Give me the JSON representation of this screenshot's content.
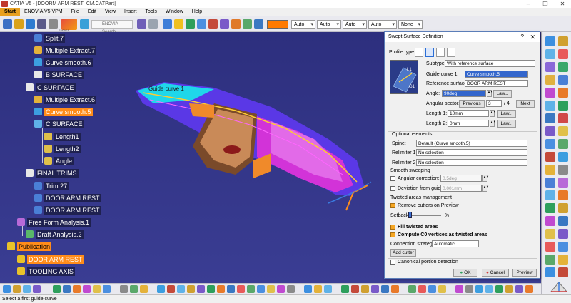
{
  "window": {
    "title": "CATIA V5 - [DOORM ARM REST_CM.CATPart]",
    "min": "–",
    "max": "❐",
    "close": "✕"
  },
  "menu": {
    "start": "Start",
    "items": [
      "ENOVIA V5 VPM",
      "File",
      "Edit",
      "View",
      "Insert",
      "Tools",
      "Window",
      "Help"
    ]
  },
  "toolbar": {
    "enovia_label": "ENOVIA",
    "search_placeholder": "ENOVIA Search",
    "color_swatch": "#ff7a00",
    "combo1": "Auto",
    "combo2": "Auto",
    "combo3": "Auto",
    "combo4": "Auto",
    "combo5": "None"
  },
  "tree": {
    "items": [
      {
        "label": "Split.7"
      },
      {
        "label": "Multiple Extract.7"
      },
      {
        "label": "Curve smooth.6"
      },
      {
        "label": "B SURFACE"
      },
      {
        "label": "C SURFACE"
      },
      {
        "label": "Multiple Extract.6"
      },
      {
        "label": "Curve smooth.5"
      },
      {
        "label": "C SURFACE"
      },
      {
        "label": "Length1"
      },
      {
        "label": "Length2"
      },
      {
        "label": "Angle"
      },
      {
        "label": "FINAL TRIMS"
      },
      {
        "label": "Trim.27"
      },
      {
        "label": "DOOR ARM REST"
      },
      {
        "label": "DOOR ARM REST"
      },
      {
        "label": "Free Form Analysis.1"
      },
      {
        "label": "Draft Analysis.2"
      },
      {
        "label": "Publication"
      },
      {
        "label": "DOOR ARM REST"
      },
      {
        "label": "TOOLING AXIS"
      }
    ]
  },
  "viewport": {
    "guide_curve_label": "Guide curve 1"
  },
  "dialog": {
    "title": "Swept Surface Definition",
    "help": "?",
    "close": "✕",
    "profile_type_label": "Profile type:",
    "subtype_label": "Subtype:",
    "subtype_value": "With reference surface",
    "guide_curve_label": "Guide curve 1:",
    "guide_curve_value": "Curve smooth.5",
    "reference_surface_label": "Reference surface:",
    "reference_surface_value": "DOOR ARM REST",
    "angle_label": "Angle:",
    "angle_value": "90deg",
    "law_button": "Law...",
    "angular_sector_label": "Angular sector:",
    "previous_button": "Previous",
    "sector_current": "3",
    "sector_total": "/ 4",
    "next_button": "Next",
    "length1_label": "Length 1:",
    "length1_value": "10mm",
    "length2_label": "Length 2:",
    "length2_value": "0mm",
    "optional_elements_label": "Optional elements",
    "spine_label": "Spine:",
    "spine_value": "Default (Curve smooth.5)",
    "relimiter1_label": "Relimiter 1:",
    "relimiter1_value": "No selection",
    "relimiter2_label": "Relimiter 2:",
    "relimiter2_value": "No selection",
    "smooth_sweeping_label": "Smooth sweeping",
    "angular_correction_label": "Angular correction:",
    "angular_correction_value": "0.5deg",
    "deviation_label": "Deviation from guide(s):",
    "deviation_value": "0.001mm",
    "twisted_label": "Twisted areas management",
    "remove_cutters_label": "Remove cutters on Preview",
    "setback_label": "Setback",
    "setback_unit": "%",
    "fill_twisted_label": "Fill twisted areas",
    "compute_c0_label": "Compute C0 vertices as twisted areas",
    "connection_strategy_label": "Connection strategy:",
    "connection_strategy_value": "Automatic",
    "add_cutter_button": "Add cutter",
    "canonical_label": "Canonical portion detection",
    "ok_button": "OK",
    "cancel_button": "Cancel",
    "preview_button": "Preview",
    "preview_labels": {
      "l1": "L1",
      "g1": "G1"
    }
  },
  "status": {
    "text": "Select a first guide curve"
  }
}
